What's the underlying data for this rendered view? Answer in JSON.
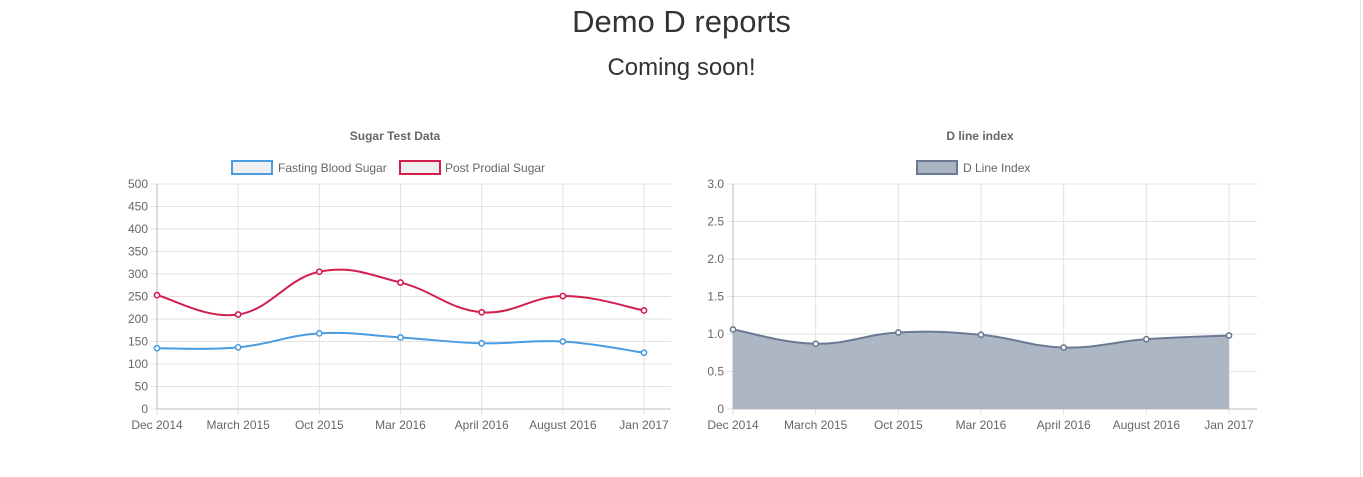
{
  "page": {
    "title": "Demo D reports",
    "subtitle": "Coming soon!"
  },
  "colors": {
    "fasting": "#4a9de0",
    "post_prandial": "#d21f4f",
    "d_line": "#6a7a95",
    "d_line_fill": "#a9b3c1",
    "grid": "#e2e2e2",
    "text": "#666666"
  },
  "chart_data": [
    {
      "type": "line",
      "title": "Sugar Test Data",
      "categories": [
        "Dec 2014",
        "March 2015",
        "Oct 2015",
        "Mar 2016",
        "April 2016",
        "August 2016",
        "Jan 2017"
      ],
      "y_ticks": [
        "500",
        "450",
        "400",
        "350",
        "300",
        "250",
        "200",
        "150",
        "100",
        "50",
        "0"
      ],
      "ylim": [
        0,
        500
      ],
      "grid": true,
      "legend_position": "top",
      "series": [
        {
          "name": "Fasting Blood Sugar",
          "values": [
            135,
            137,
            168,
            159,
            146,
            150,
            125
          ],
          "fill": false
        },
        {
          "name": "Post Prodial Sugar",
          "values": [
            253,
            210,
            305,
            281,
            215,
            251,
            219
          ],
          "fill": false
        }
      ]
    },
    {
      "type": "area",
      "title": "D line index",
      "categories": [
        "Dec 2014",
        "March 2015",
        "Oct 2015",
        "Mar 2016",
        "April 2016",
        "August 2016",
        "Jan 2017"
      ],
      "y_ticks": [
        "3.0",
        "2.5",
        "2.0",
        "1.5",
        "1.0",
        "0.5",
        "0"
      ],
      "ylim": [
        0,
        3
      ],
      "grid": true,
      "legend_position": "top",
      "series": [
        {
          "name": "D Line Index",
          "values": [
            1.06,
            0.87,
            1.02,
            0.99,
            0.82,
            0.93,
            0.98
          ],
          "fill": true
        }
      ]
    }
  ]
}
